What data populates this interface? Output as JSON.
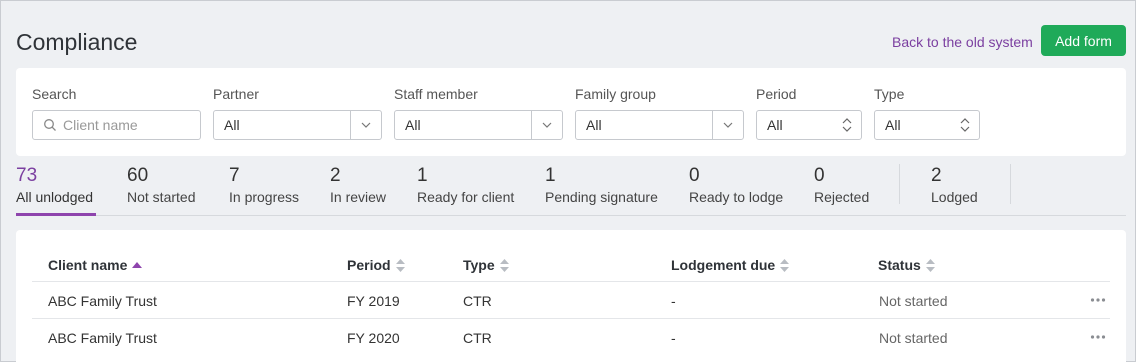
{
  "header": {
    "title": "Compliance",
    "back_link": "Back to the old system",
    "add_button": "Add form"
  },
  "filters": {
    "search": {
      "label": "Search",
      "placeholder": "Client name"
    },
    "partner": {
      "label": "Partner",
      "value": "All"
    },
    "staff": {
      "label": "Staff member",
      "value": "All"
    },
    "family": {
      "label": "Family group",
      "value": "All"
    },
    "period": {
      "label": "Period",
      "value": "All"
    },
    "type": {
      "label": "Type",
      "value": "All"
    }
  },
  "tabs": [
    {
      "count": "73",
      "label": "All unlodged"
    },
    {
      "count": "60",
      "label": "Not started"
    },
    {
      "count": "7",
      "label": "In progress"
    },
    {
      "count": "2",
      "label": "In review"
    },
    {
      "count": "1",
      "label": "Ready for client"
    },
    {
      "count": "1",
      "label": "Pending signature"
    },
    {
      "count": "0",
      "label": "Ready to lodge"
    },
    {
      "count": "0",
      "label": "Rejected"
    },
    {
      "count": "2",
      "label": "Lodged"
    }
  ],
  "table": {
    "columns": {
      "client": "Client name",
      "period": "Period",
      "type": "Type",
      "due": "Lodgement due",
      "status": "Status"
    },
    "rows": [
      {
        "client": "ABC Family Trust",
        "period": "FY 2019",
        "type": "CTR",
        "due": "-",
        "status": "Not started"
      },
      {
        "client": "ABC Family Trust",
        "period": "FY 2020",
        "type": "CTR",
        "due": "-",
        "status": "Not started"
      }
    ]
  },
  "colors": {
    "accent": "#7b3fa0",
    "primary_button": "#1faa59"
  }
}
